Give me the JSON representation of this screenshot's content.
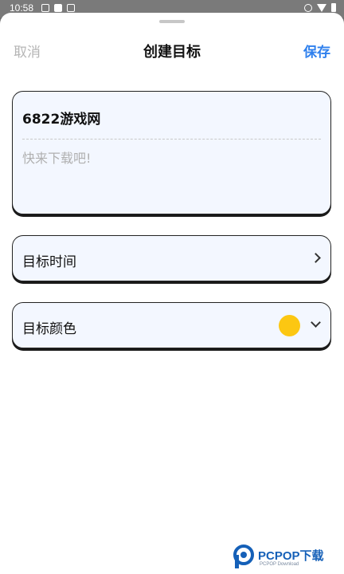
{
  "status_bar": {
    "time": "10:58",
    "left_icons": [
      "image-icon",
      "app-icon",
      "app-icon-2"
    ],
    "right_icons": [
      "dnd-icon",
      "wifi-icon",
      "battery-icon"
    ]
  },
  "header": {
    "cancel_label": "取消",
    "title": "创建目标",
    "save_label": "保存",
    "accent_color": "#2f80ed"
  },
  "goal": {
    "name": "6822游戏网",
    "description_placeholder": "快来下载吧!"
  },
  "rows": {
    "time_label": "目标时间",
    "color_label": "目标颜色",
    "selected_color": "#fcc712"
  },
  "watermark": {
    "brand": "PCPOP下载",
    "sub": "PCPOP Download"
  }
}
